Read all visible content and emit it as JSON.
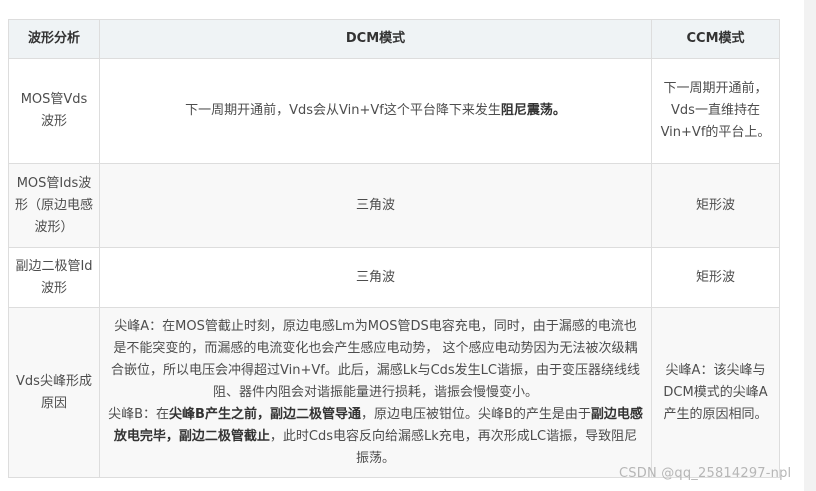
{
  "table": {
    "headers": [
      "波形分析",
      "DCM模式",
      "CCM模式"
    ],
    "rows": [
      {
        "label": "MOS管Vds波形",
        "dcm_pre": "下一周期开通前，Vds会从Vin+Vf这个平台降下来发生",
        "dcm_bold": "阻尼震荡。",
        "ccm": "下一周期开通前，Vds一直维持在Vin+Vf的平台上。"
      },
      {
        "label": "MOS管Ids波形（原边电感波形）",
        "dcm": "三角波",
        "ccm": "矩形波"
      },
      {
        "label": "副边二极管Id波形",
        "dcm": "三角波",
        "ccm": "矩形波"
      },
      {
        "label": "Vds尖峰形成原因",
        "dcm_a": "尖峰A：在MOS管截止时刻，原边电感Lm为MOS管DS电容充电，同时，由于漏感的电流也是不能突变的，而漏感的电流变化也会产生感应电动势， 这个感应电动势因为无法被次级耦合嵌位，所以电压会冲得超过Vin+Vf。此后，漏感Lk与Cds发生LC谐振，由于变压器绕线线阻、器件内阻会对谐振能量进行损耗，谐振会慢慢变小。",
        "dcm_b1": "尖峰B：在",
        "dcm_b2": "尖峰B产生之前，副边二极管导通",
        "dcm_b3": "，原边电压被钳位。尖峰B的产生是由于",
        "dcm_b4": "副边电感放电完毕，副边二极管截止",
        "dcm_b5": "，此时Cds电容反向给漏感Lk充电，再次形成LC谐振，导致阻尼振荡。",
        "ccm": "尖峰A：该尖峰与DCM模式的尖峰A产生的原因相同。"
      }
    ]
  },
  "watermark": "CSDN @qq_25814297-npl"
}
